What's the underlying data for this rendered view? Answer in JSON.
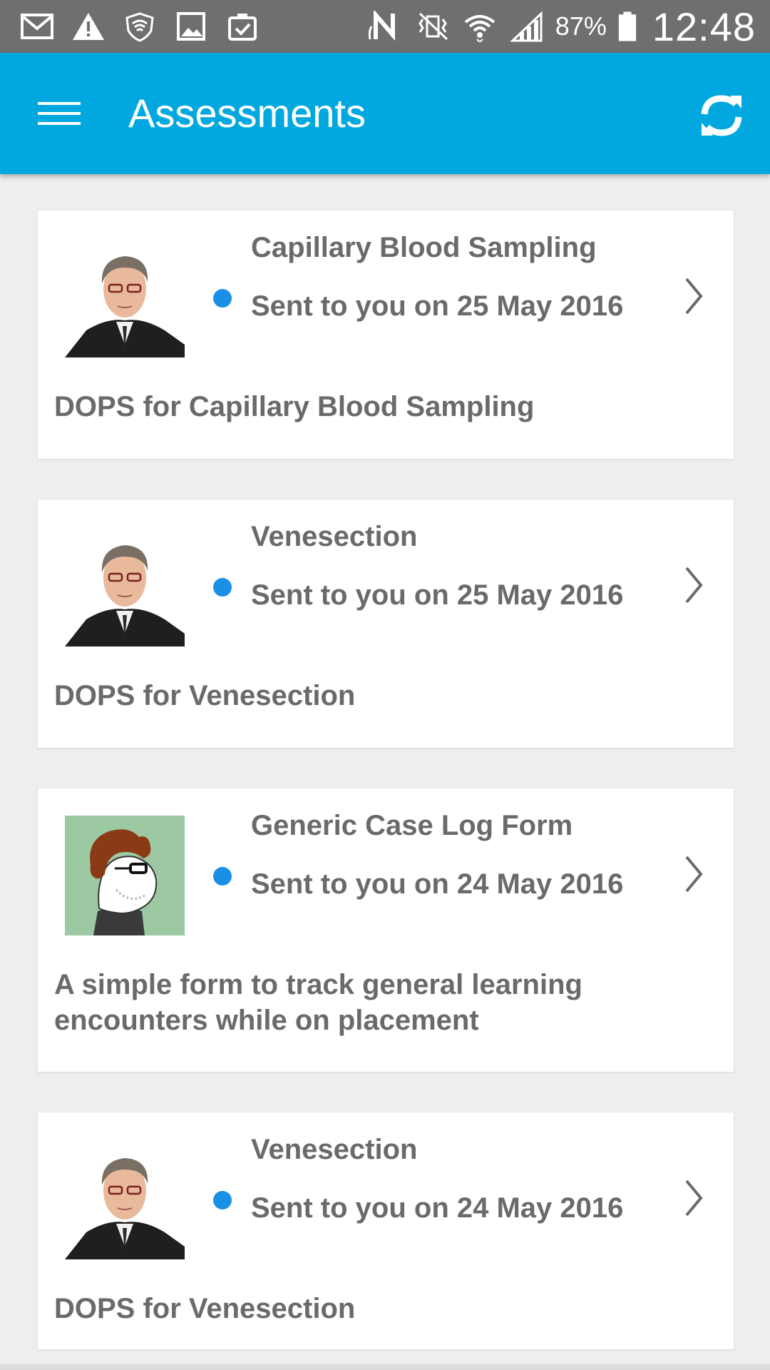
{
  "status_bar": {
    "battery_percent": "87%",
    "time": "12:48",
    "icons_left": [
      "gmail-icon",
      "warning-icon",
      "vpn-icon",
      "image-icon",
      "clipboard-check-icon"
    ],
    "icons_right": [
      "nfc-icon",
      "vibrate-icon",
      "wifi-icon",
      "signal-icon",
      "battery-icon"
    ]
  },
  "app_bar": {
    "title": "Assessments",
    "menu_icon": "hamburger-icon",
    "refresh_icon": "refresh-icon",
    "color": "#00a8df"
  },
  "accent_dot_color": "#1a8fe6",
  "cards": [
    {
      "title": "Capillary Blood Sampling",
      "date": "Sent to you on 25 May 2016",
      "description": "DOPS for Capillary Blood Sampling",
      "avatar": "man-portrait"
    },
    {
      "title": "Venesection",
      "date": "Sent to you on 25 May 2016",
      "description": "DOPS for Venesection",
      "avatar": "man-portrait"
    },
    {
      "title": "Generic Case Log Form",
      "date": "Sent to you on 24 May 2016",
      "description": "A simple form to track general learning encounters while on placement",
      "avatar": "cartoon-portrait"
    },
    {
      "title": "Venesection",
      "date": "Sent to you on 24 May 2016",
      "description": "DOPS for Venesection",
      "avatar": "man-portrait"
    }
  ]
}
